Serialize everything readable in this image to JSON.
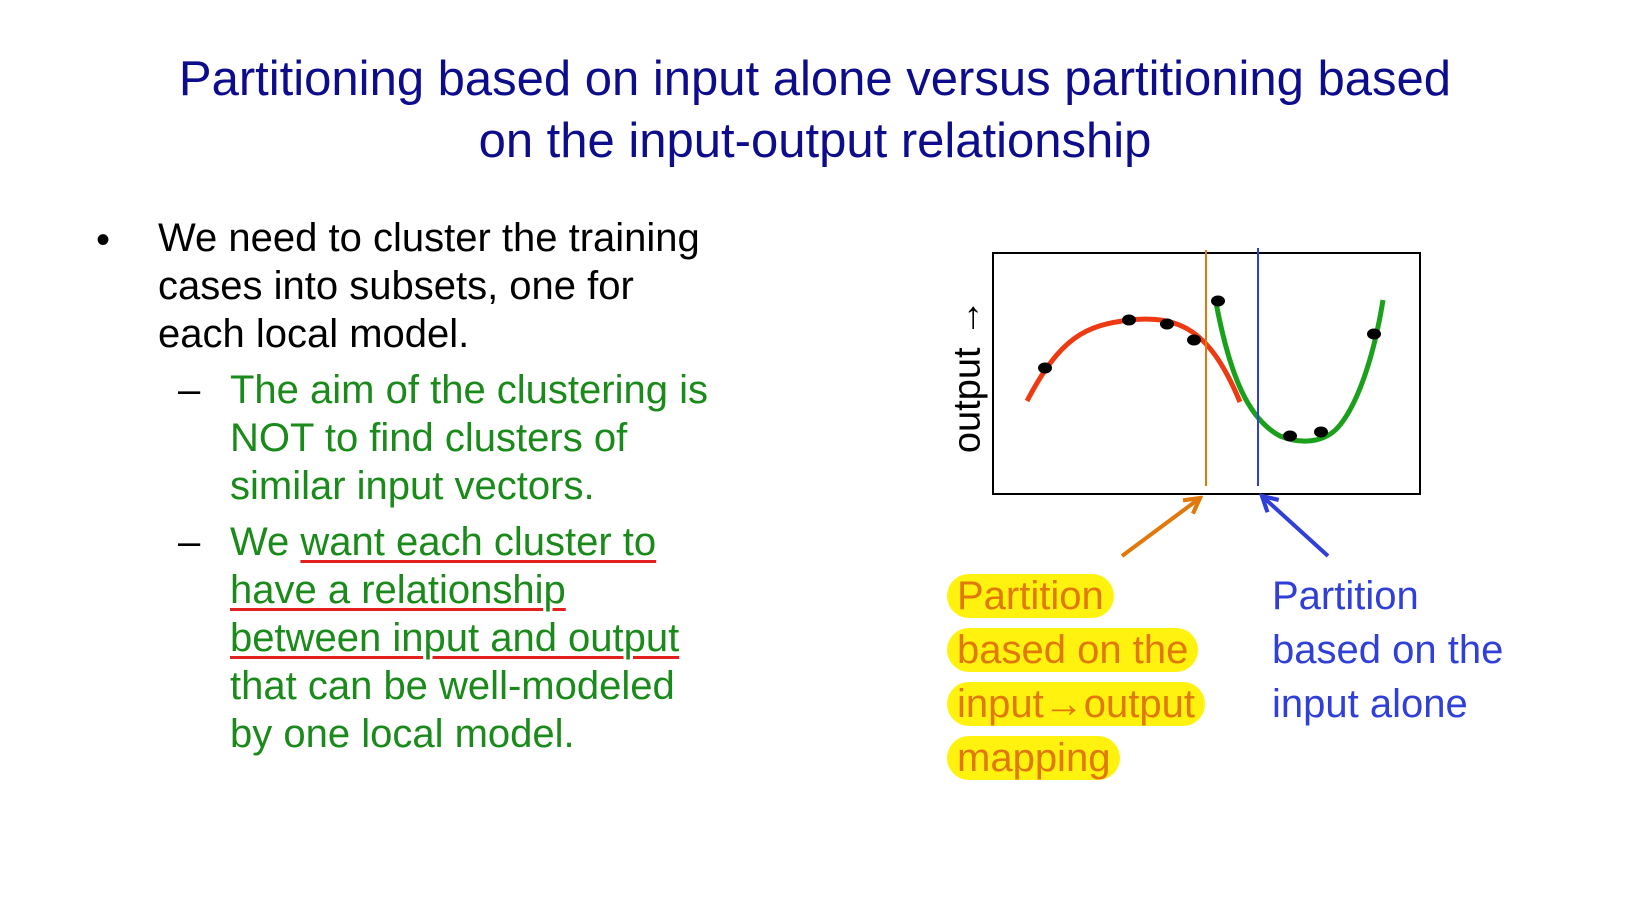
{
  "title": {
    "line1": "Partitioning based on input alone versus partitioning based",
    "line2": "on the input-output relationship"
  },
  "bullet": {
    "marker": "•",
    "lines": [
      "We need to cluster the training",
      "cases into subsets, one for",
      "each local model."
    ]
  },
  "sub1": {
    "marker": "–",
    "lines": [
      "The aim of the clustering is",
      "NOT to find clusters of",
      "similar input vectors."
    ]
  },
  "sub2": {
    "marker": "–",
    "line1_plain": "We ",
    "line1_underlined": "want each cluster to",
    "line2_underlined": "have a relationship",
    "line3_underlined": "between input and output",
    "line4": "that can be well-modeled",
    "line5": "by one local model."
  },
  "diagram": {
    "ylabel": "output",
    "ylabel_arrow": "→",
    "colors": {
      "red_curve": "#ee3a12",
      "green_curve": "#1aa01a",
      "orange_partition": "#e0780a",
      "blue_partition": "#2f3fd8",
      "points": "#000000"
    },
    "orange_label": [
      "Partition",
      "based on the",
      "input→output",
      "mapping"
    ],
    "blue_label": [
      "Partition",
      "based on the",
      "input alone"
    ]
  }
}
